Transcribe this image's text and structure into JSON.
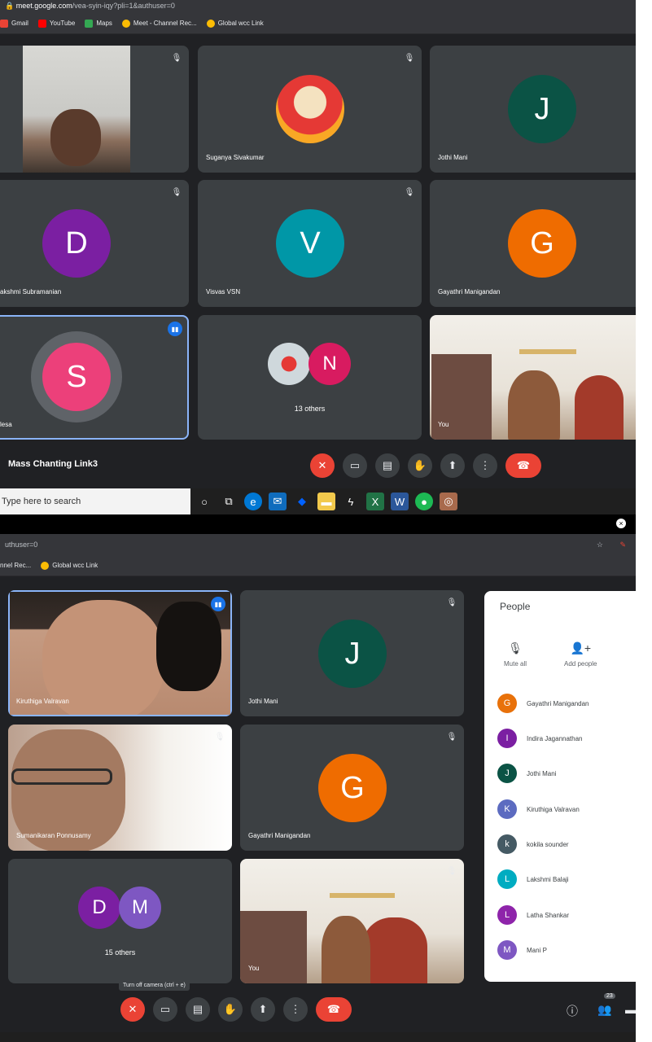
{
  "shot1": {
    "url_domain": "meet.google.com",
    "url_rest": "/vea-syin-iqy?pli=1&authuser=0",
    "bookmarks": [
      "Gmail",
      "YouTube",
      "Maps",
      "Meet - Channel Rec...",
      "Global wcc Link"
    ],
    "tiles": {
      "t1": {
        "name": ""
      },
      "t2": {
        "name": "Suganya Sivakumar"
      },
      "t3": {
        "name": "Jothi Mani",
        "initial": "J"
      },
      "t4": {
        "name": "akshmi Subramanian",
        "initial": "D"
      },
      "t5": {
        "name": "Visvas VSN",
        "initial": "V"
      },
      "t6": {
        "name": "Gayathri Manigandan",
        "initial": "G"
      },
      "t7": {
        "name": "lesa",
        "initial": "S"
      },
      "t8": {
        "name": "13 others",
        "initial": "N"
      },
      "t9": {
        "name": "You"
      }
    },
    "meeting_name": "Mass Chanting Link3",
    "search_placeholder": "Type here to search"
  },
  "shot2": {
    "url_rest": "uthuser=0",
    "bookmarks": [
      "nnel Rec...",
      "Global wcc Link"
    ],
    "tiles": {
      "u1": {
        "name": "Kiruthiga Valravan"
      },
      "u2": {
        "name": "Jothi Mani",
        "initial": "J"
      },
      "u3": {
        "name": "Sumanikaran Ponnusamy"
      },
      "u4": {
        "name": "Gayathri Manigandan",
        "initial": "G"
      },
      "u5": {
        "name": "15 others",
        "initial_a": "D",
        "initial_b": "M"
      },
      "u6": {
        "name": "You"
      }
    },
    "tooltip": "Turn off camera (ctrl + e)",
    "people_count": "23",
    "people_panel": {
      "title": "People",
      "mute_all": "Mute all",
      "add_people": "Add people",
      "list": [
        {
          "initial": "G",
          "name": "Gayathri Manigandan",
          "color": "#e8710a"
        },
        {
          "initial": "I",
          "name": "Indira Jagannathan",
          "color": "#7b1fa2"
        },
        {
          "initial": "J",
          "name": "Jothi Mani",
          "color": "#0b5345"
        },
        {
          "initial": "K",
          "name": "Kiruthiga Valravan",
          "color": "#5c6bc0"
        },
        {
          "initial": "k",
          "name": "kokila sounder",
          "color": "#455a64"
        },
        {
          "initial": "L",
          "name": "Lakshmi Balaji",
          "color": "#00acc1"
        },
        {
          "initial": "L",
          "name": "Latha Shankar",
          "color": "#8e24aa"
        },
        {
          "initial": "M",
          "name": "Mani P",
          "color": "#7e57c2"
        }
      ]
    }
  },
  "colors": {
    "meet_bg": "#202124",
    "tile_bg": "#3c4043",
    "hangup": "#ea4335",
    "active_border": "#8ab4f8"
  }
}
